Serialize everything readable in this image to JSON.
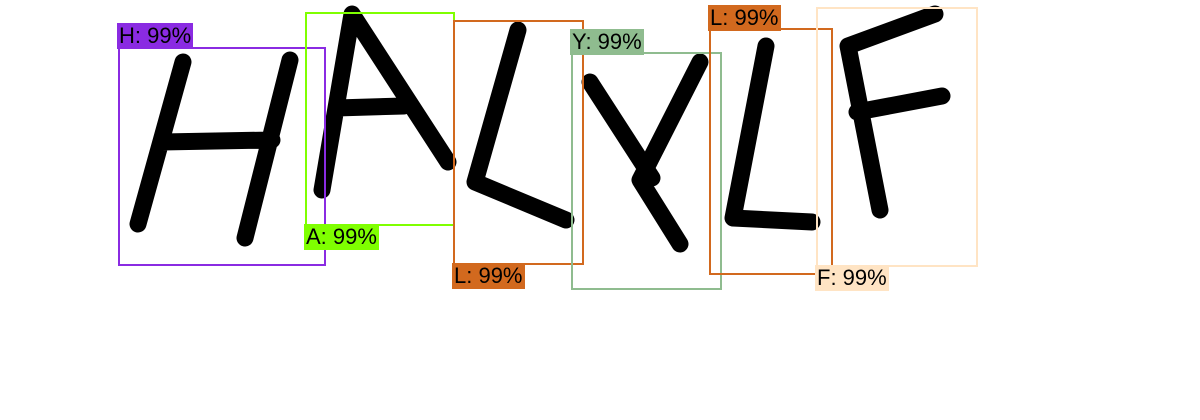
{
  "detections": [
    {
      "label": "H: 99%",
      "color": "#8a2be2"
    },
    {
      "label": "A: 99%",
      "color": "#7fff00"
    },
    {
      "label": "L: 99%",
      "color": "#d2691e"
    },
    {
      "label": "Y: 99%",
      "color": "#8fbc8f"
    },
    {
      "label": "L: 99%",
      "color": "#d2691e"
    },
    {
      "label": "F: 99%",
      "color": "#ffe4c4"
    }
  ]
}
